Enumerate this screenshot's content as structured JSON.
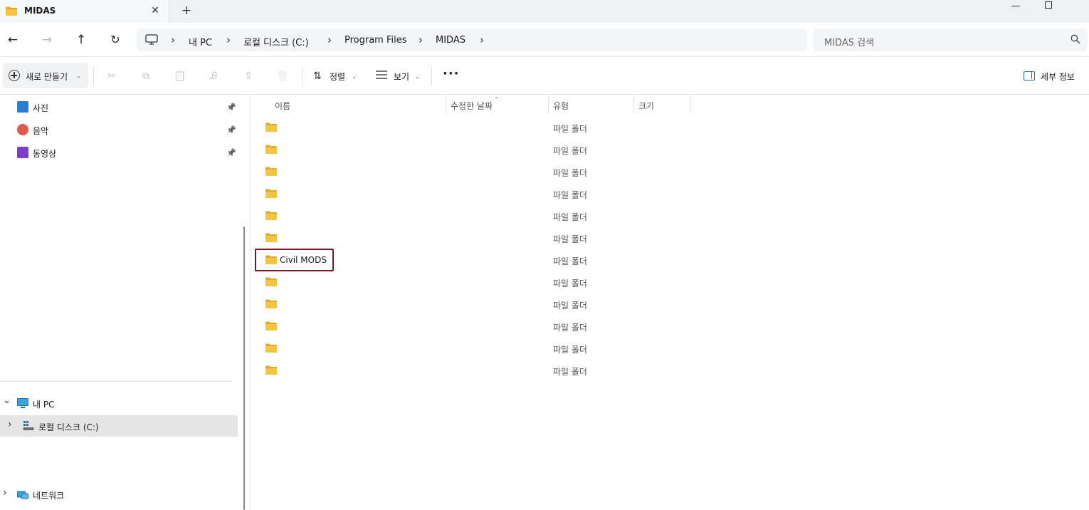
{
  "window": {
    "tab_title": "MIDAS",
    "tab_close": "✕",
    "new_tab": "+",
    "minimize": "—"
  },
  "nav": {
    "back": "←",
    "forward": "→",
    "up": "↑",
    "refresh": "↻"
  },
  "breadcrumb": {
    "items": [
      "내 PC",
      "로컬 디스크 (C:)",
      "Program Files",
      "MIDAS"
    ],
    "separator": "›"
  },
  "search": {
    "placeholder": "MIDAS 검색"
  },
  "toolbar": {
    "new_label": "새로 만들기",
    "sort_label": "정렬",
    "view_label": "보기",
    "more": "···",
    "details_label": "세부 정보",
    "cut": "✂",
    "copy": "⧉",
    "paste": "📋",
    "rename": "Ꭿ",
    "share": "⇪",
    "delete": "🗑"
  },
  "sidebar": {
    "quick_access": [
      {
        "label": "사진",
        "icon": "pictures-icon",
        "color": "#2b7cd3"
      },
      {
        "label": "음악",
        "icon": "music-icon",
        "color": "#e05a4a"
      },
      {
        "label": "동영상",
        "icon": "videos-icon",
        "color": "#7b3fc4"
      }
    ],
    "pin": "📌",
    "this_pc": "내 PC",
    "local_disk": "로컬 디스크 (C:)",
    "network": "네트워크",
    "chev_expanded": "⌄",
    "chev_collapsed": "›"
  },
  "columns": {
    "name": "이름",
    "modified": "수정한 날짜",
    "type": "유형",
    "size": "크기"
  },
  "files": [
    {
      "name": "",
      "type": "파일 폴더"
    },
    {
      "name": "",
      "type": "파일 폴더"
    },
    {
      "name": "",
      "type": "파일 폴더"
    },
    {
      "name": "",
      "type": "파일 폴더"
    },
    {
      "name": "",
      "type": "파일 폴더"
    },
    {
      "name": "",
      "type": "파일 폴더"
    },
    {
      "name": "Civil MODS",
      "type": "파일 폴더"
    },
    {
      "name": "",
      "type": "파일 폴더"
    },
    {
      "name": "",
      "type": "파일 폴더"
    },
    {
      "name": "",
      "type": "파일 폴더"
    },
    {
      "name": "",
      "type": "파일 폴더"
    },
    {
      "name": "",
      "type": "파일 폴더"
    }
  ],
  "colors": {
    "folder": "#f5c542",
    "folder_dark": "#e2a92a",
    "highlight_border": "#7a1328",
    "accent": "#1a73b8"
  }
}
